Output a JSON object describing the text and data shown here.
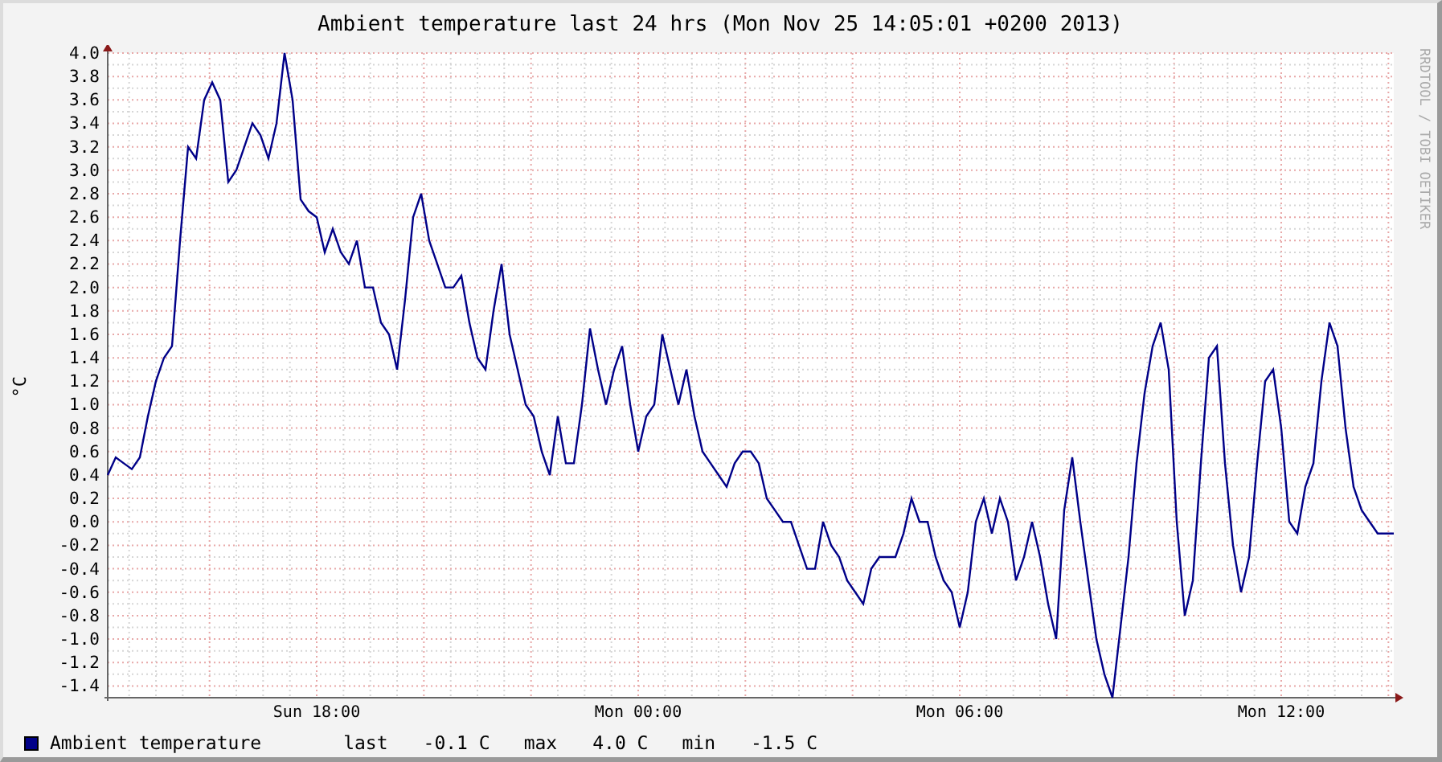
{
  "graph": {
    "title": "Ambient temperature last 24 hrs (Mon Nov 25 14:05:01 +0200 2013)",
    "vendor_label": "RRDTOOL / TOBI OETIKER",
    "chart_data": {
      "type": "line",
      "ylabel": "°C",
      "categories": [
        null,
        null,
        null,
        null,
        null,
        null,
        null,
        null,
        null,
        null,
        null,
        null,
        null,
        null,
        null,
        null,
        null,
        null,
        null,
        null,
        null,
        null,
        null,
        null,
        null,
        null,
        "Sun 18:00",
        null,
        null,
        null,
        null,
        null,
        null,
        null,
        null,
        null,
        null,
        null,
        null,
        null,
        null,
        null,
        null,
        null,
        null,
        null,
        null,
        null,
        null,
        null,
        null,
        null,
        null,
        null,
        null,
        null,
        null,
        null,
        null,
        null,
        null,
        null,
        null,
        null,
        null,
        null,
        "Mon 00:00",
        null,
        null,
        null,
        null,
        null,
        null,
        null,
        null,
        null,
        null,
        null,
        null,
        null,
        null,
        null,
        null,
        null,
        null,
        null,
        null,
        null,
        null,
        null,
        null,
        null,
        null,
        null,
        null,
        null,
        null,
        null,
        null,
        null,
        null,
        null,
        null,
        null,
        null,
        null,
        "Mon 06:00",
        null,
        null,
        null,
        null,
        null,
        null,
        null,
        null,
        null,
        null,
        null,
        null,
        null,
        null,
        null,
        null,
        null,
        null,
        null,
        null,
        null,
        null,
        null,
        null,
        null,
        null,
        null,
        null,
        null,
        null,
        null,
        null,
        null,
        null,
        null,
        null,
        null,
        null,
        null,
        "Mon 12:00",
        null,
        null,
        null,
        null,
        null,
        null,
        null,
        null,
        null,
        null,
        null,
        null,
        null,
        null
      ],
      "series": [
        {
          "name": "Ambient temperature",
          "color": "#000088",
          "values": [
            0.4,
            0.55,
            0.5,
            0.45,
            0.55,
            0.9,
            1.2,
            1.4,
            1.5,
            2.4,
            3.2,
            3.1,
            3.6,
            3.75,
            3.6,
            2.9,
            3.0,
            3.2,
            3.4,
            3.3,
            3.1,
            3.4,
            4.0,
            3.6,
            2.75,
            2.65,
            2.6,
            2.3,
            2.5,
            2.3,
            2.2,
            2.4,
            2.0,
            2.0,
            1.7,
            1.6,
            1.3,
            1.9,
            2.6,
            2.8,
            2.4,
            2.2,
            2.0,
            2.0,
            2.1,
            1.7,
            1.4,
            1.3,
            1.8,
            2.2,
            1.6,
            1.3,
            1.0,
            0.9,
            0.6,
            0.4,
            0.9,
            0.5,
            0.5,
            1.0,
            1.65,
            1.3,
            1.0,
            1.3,
            1.5,
            1.0,
            0.6,
            0.9,
            1.0,
            1.6,
            1.3,
            1.0,
            1.3,
            0.9,
            0.6,
            0.5,
            0.4,
            0.3,
            0.5,
            0.6,
            0.6,
            0.5,
            0.2,
            0.1,
            0.0,
            0.0,
            -0.2,
            -0.4,
            -0.4,
            0.0,
            -0.2,
            -0.3,
            -0.5,
            -0.6,
            -0.7,
            -0.4,
            -0.3,
            -0.3,
            -0.3,
            -0.1,
            0.2,
            0.0,
            0.0,
            -0.3,
            -0.5,
            -0.6,
            -0.9,
            -0.6,
            0.0,
            0.2,
            -0.1,
            0.2,
            0.0,
            -0.5,
            -0.3,
            0.0,
            -0.3,
            -0.7,
            -1.0,
            0.1,
            0.55,
            0.0,
            -0.5,
            -1.0,
            -1.3,
            -1.5,
            -0.9,
            -0.3,
            0.5,
            1.1,
            1.5,
            1.7,
            1.3,
            0.0,
            -0.8,
            -0.5,
            0.5,
            1.4,
            1.5,
            0.5,
            -0.2,
            -0.6,
            -0.3,
            0.5,
            1.2,
            1.3,
            0.8,
            0.0,
            -0.1,
            0.3,
            0.5,
            1.2,
            1.7,
            1.5,
            0.8,
            0.3,
            0.1,
            0.0,
            -0.1,
            -0.1,
            -0.1
          ]
        }
      ],
      "ylim": [
        -1.5,
        4.0
      ],
      "grid": true,
      "yticks": [
        {
          "value": 4.0,
          "label": "4.0"
        },
        {
          "value": 3.8,
          "label": "3.8"
        },
        {
          "value": 3.6,
          "label": "3.6"
        },
        {
          "value": 3.4,
          "label": "3.4"
        },
        {
          "value": 3.2,
          "label": "3.2"
        },
        {
          "value": 3.0,
          "label": "3.0"
        },
        {
          "value": 2.8,
          "label": "2.8"
        },
        {
          "value": 2.6,
          "label": "2.6"
        },
        {
          "value": 2.4,
          "label": "2.4"
        },
        {
          "value": 2.2,
          "label": "2.2"
        },
        {
          "value": 2.0,
          "label": "2.0"
        },
        {
          "value": 1.8,
          "label": "1.8"
        },
        {
          "value": 1.6,
          "label": "1.6"
        },
        {
          "value": 1.4,
          "label": "1.4"
        },
        {
          "value": 1.2,
          "label": "1.2"
        },
        {
          "value": 1.0,
          "label": "1.0"
        },
        {
          "value": 0.8,
          "label": "0.8"
        },
        {
          "value": 0.6,
          "label": "0.6"
        },
        {
          "value": 0.4,
          "label": "0.4"
        },
        {
          "value": 0.2,
          "label": "0.2"
        },
        {
          "value": 0,
          "label": "0.0"
        },
        {
          "value": -0.2,
          "label": "-0.2"
        },
        {
          "value": -0.4,
          "label": "-0.4"
        },
        {
          "value": -0.6,
          "label": "-0.6"
        },
        {
          "value": -0.8,
          "label": "-0.8"
        },
        {
          "value": -1.0,
          "label": "-1.0"
        },
        {
          "value": -1.2,
          "label": "-1.2"
        },
        {
          "value": -1.4,
          "label": "-1.4"
        }
      ]
    },
    "legend": {
      "stats": [
        {
          "label": "last",
          "value": "-0.1 C"
        },
        {
          "label": "max",
          "value": "4.0 C"
        },
        {
          "label": "min",
          "value": "-1.5 C"
        }
      ]
    }
  }
}
